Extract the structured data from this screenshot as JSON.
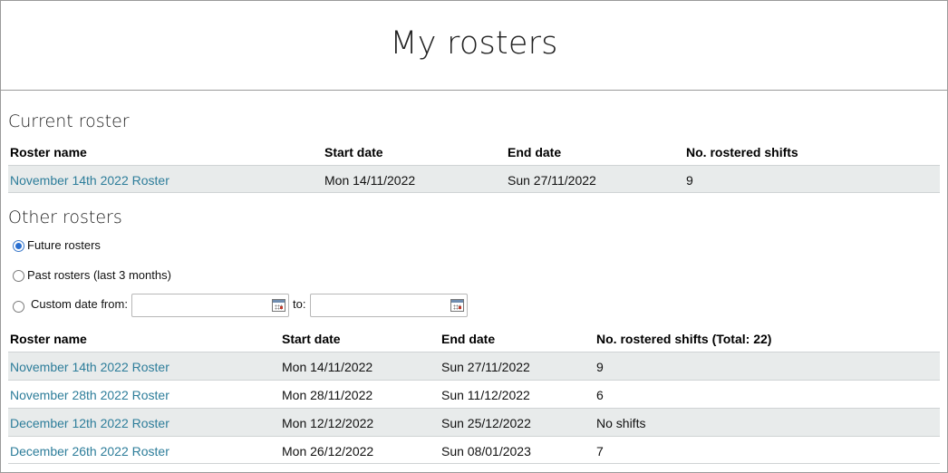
{
  "page": {
    "title": "My rosters"
  },
  "current": {
    "heading": "Current roster",
    "columns": [
      "Roster name",
      "Start date",
      "End date",
      "No. rostered shifts"
    ],
    "rows": [
      {
        "name": "November 14th 2022 Roster",
        "start": "Mon 14/11/2022",
        "end": "Sun 27/11/2022",
        "shifts": "9"
      }
    ]
  },
  "other": {
    "heading": "Other rosters",
    "filters": {
      "future_label": "Future rosters",
      "past_label": "Past rosters (last 3 months)",
      "custom_label": "Custom date from:",
      "to_label": "to:",
      "from_value": "",
      "to_value": "",
      "selected": "future"
    },
    "columns": [
      "Roster name",
      "Start date",
      "End date",
      "No. rostered shifts (Total: 22)"
    ],
    "rows": [
      {
        "name": "November 14th 2022 Roster",
        "start": "Mon 14/11/2022",
        "end": "Sun 27/11/2022",
        "shifts": "9"
      },
      {
        "name": "November 28th 2022 Roster",
        "start": "Mon 28/11/2022",
        "end": "Sun 11/12/2022",
        "shifts": "6"
      },
      {
        "name": "December 12th 2022 Roster",
        "start": "Mon 12/12/2022",
        "end": "Sun 25/12/2022",
        "shifts": "No shifts"
      },
      {
        "name": "December 26th 2022 Roster",
        "start": "Mon 26/12/2022",
        "end": "Sun 08/01/2023",
        "shifts": "7"
      }
    ]
  },
  "colors": {
    "link": "#2d7d9a",
    "row_alt": "#e8ebeb",
    "border": "#9a9a9a"
  }
}
